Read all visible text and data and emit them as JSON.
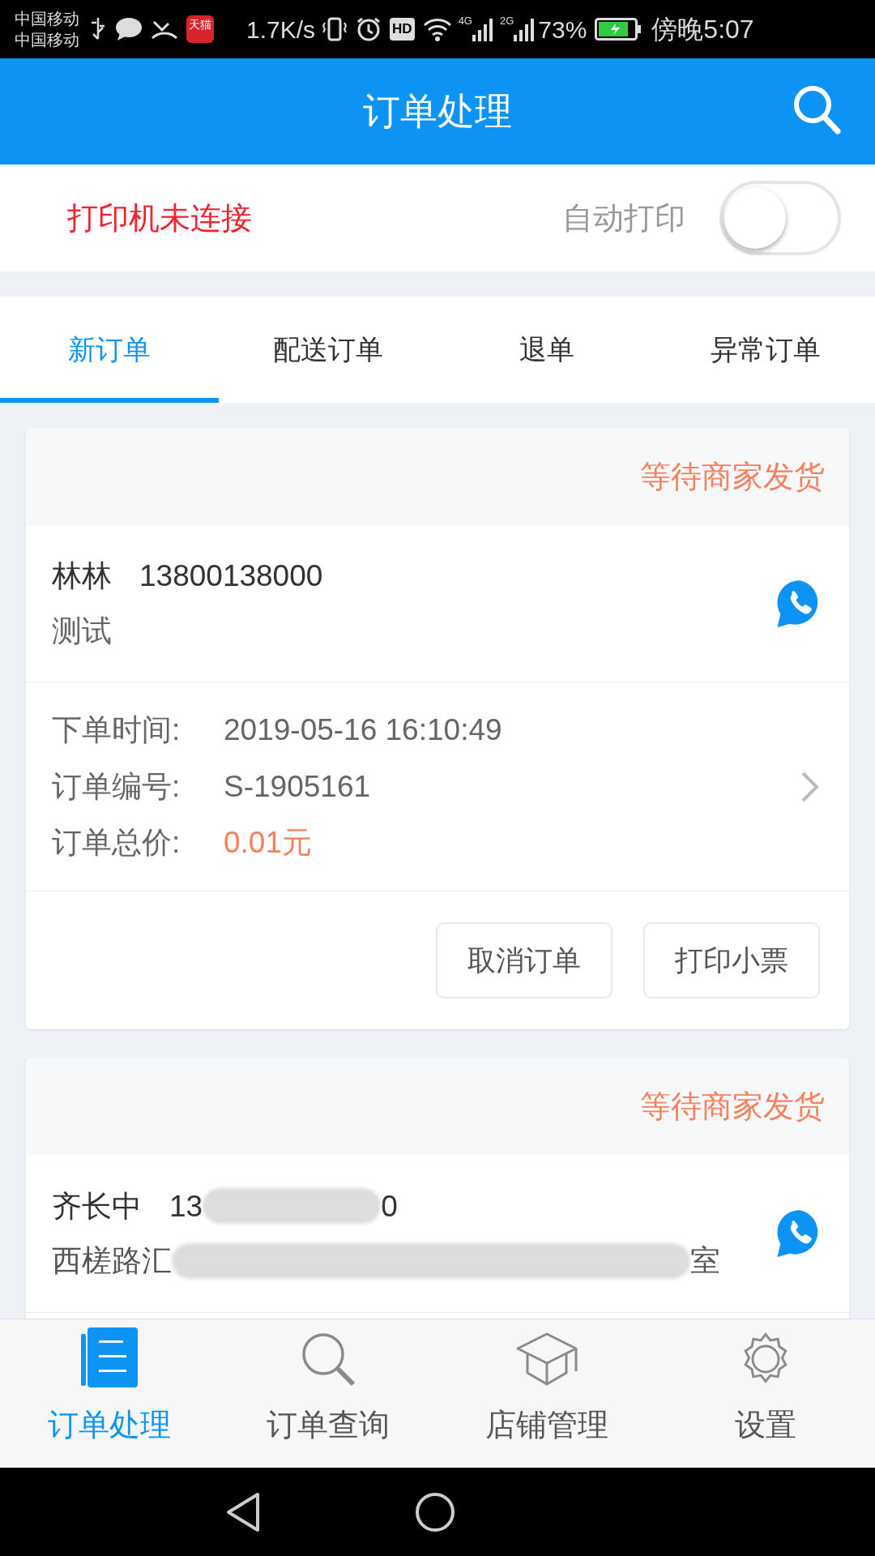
{
  "status_bar": {
    "carriers": [
      "中国移动",
      "中国移动"
    ],
    "app_badge": "天猫",
    "net_speed": "1.7K/s",
    "hd": "HD",
    "sim1_net": "4G",
    "sim2_net": "2G",
    "battery": "73%",
    "time": "傍晚5:07"
  },
  "app_bar": {
    "title": "订单处理"
  },
  "printer": {
    "status": "打印机未连接",
    "auto_print_label": "自动打印",
    "auto_print_on": false
  },
  "tabs": [
    {
      "label": "新订单",
      "selected": true
    },
    {
      "label": "配送订单",
      "selected": false
    },
    {
      "label": "退单",
      "selected": false
    },
    {
      "label": "异常订单",
      "selected": false
    }
  ],
  "orders": [
    {
      "status": "等待商家发货",
      "name": "林林",
      "phone": "13800138000",
      "note": "测试",
      "fields": [
        {
          "label": "下单时间:",
          "value": "2019-05-16 16:10:49",
          "kind": "plain"
        },
        {
          "label": "订单编号:",
          "value": "S-1905161",
          "kind": "plain"
        },
        {
          "label": "订单总价:",
          "value": "0.01元",
          "kind": "price"
        }
      ],
      "buttons": [
        "取消订单",
        "打印小票"
      ]
    },
    {
      "status": "等待商家发货",
      "name": "齐长中",
      "phone_start": "13",
      "phone_end": "0",
      "address_start": "西槎路汇",
      "address_end": "室"
    }
  ],
  "bottom_nav": [
    {
      "label": "订单处理",
      "selected": true,
      "kind": "orders"
    },
    {
      "label": "订单查询",
      "selected": false,
      "kind": "search"
    },
    {
      "label": "店铺管理",
      "selected": false,
      "kind": "shop"
    },
    {
      "label": "设置",
      "selected": false,
      "kind": "settings"
    }
  ]
}
